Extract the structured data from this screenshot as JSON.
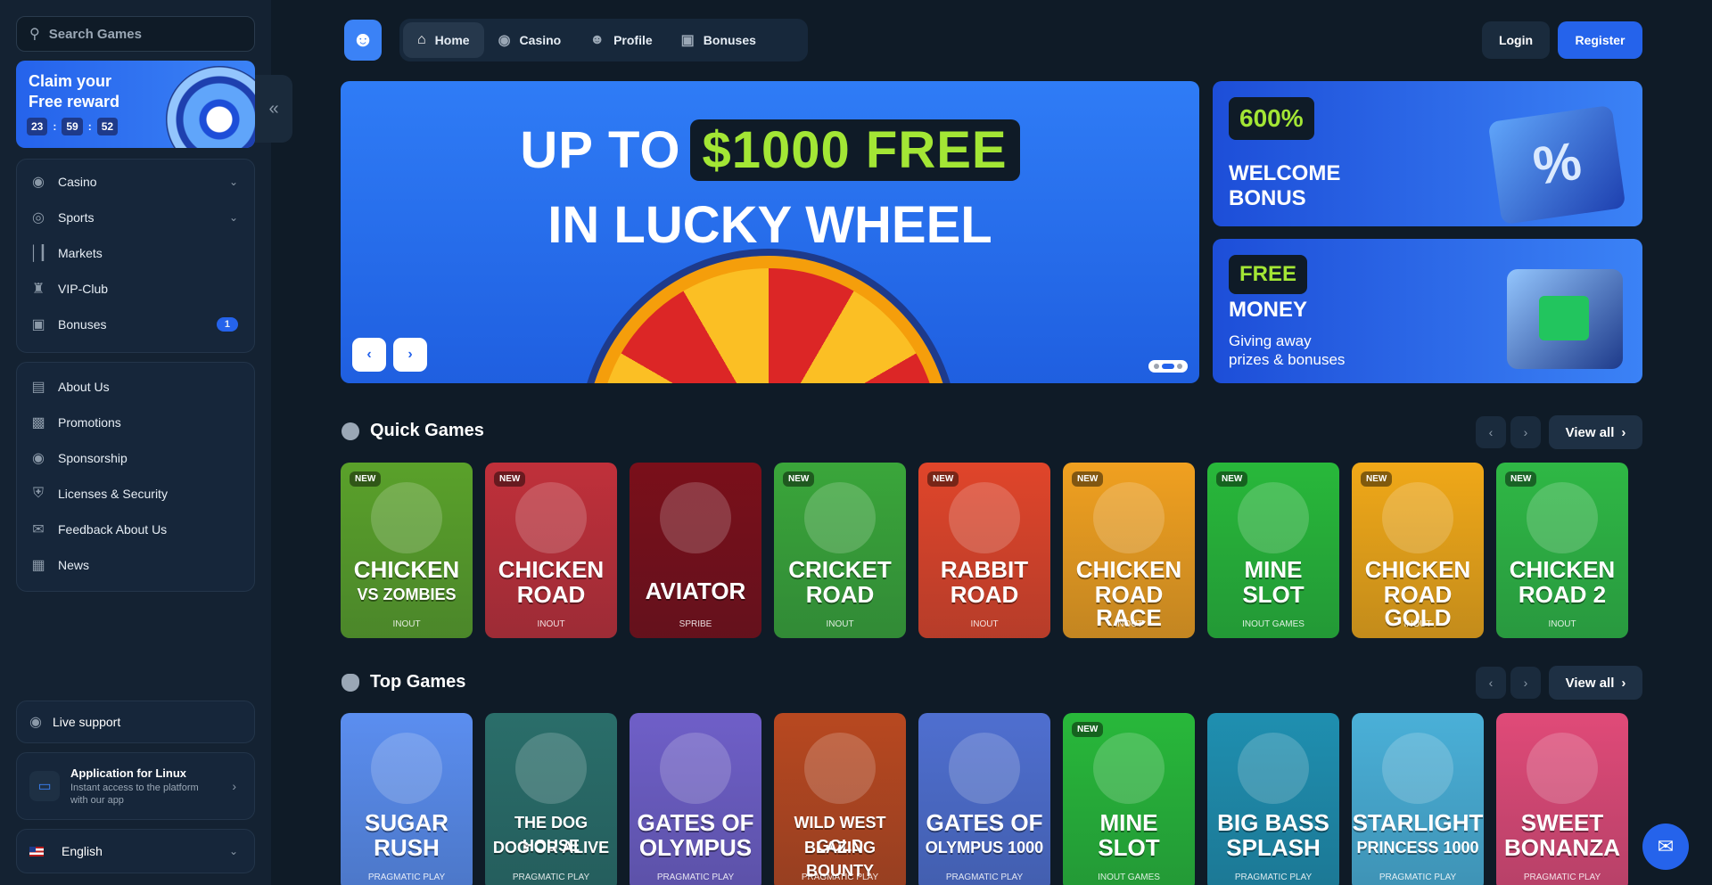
{
  "search": {
    "placeholder": "Search Games"
  },
  "reward": {
    "title_line1": "Claim your",
    "title_line2": "Free reward",
    "hours": "23",
    "minutes": "59",
    "seconds": "52"
  },
  "sidebar": {
    "main_items": [
      {
        "label": "Casino",
        "icon": "casino-chip-icon",
        "expandable": true
      },
      {
        "label": "Sports",
        "icon": "globe-icon",
        "expandable": true
      },
      {
        "label": "Markets",
        "icon": "candlestick-icon"
      },
      {
        "label": "VIP-Club",
        "icon": "crown-icon"
      },
      {
        "label": "Bonuses",
        "icon": "gift-icon",
        "badge": "1"
      }
    ],
    "info_items": [
      {
        "label": "About Us",
        "icon": "book-icon"
      },
      {
        "label": "Promotions",
        "icon": "promo-icon"
      },
      {
        "label": "Sponsorship",
        "icon": "sponsor-icon"
      },
      {
        "label": "Licenses & Security",
        "icon": "shield-icon"
      },
      {
        "label": "Feedback About Us",
        "icon": "feedback-icon"
      },
      {
        "label": "News",
        "icon": "news-icon"
      }
    ],
    "live_support": "Live support",
    "app": {
      "title": "Application for Linux",
      "subtitle_line1": "Instant access to the platform",
      "subtitle_line2": "with our app"
    },
    "language": "English"
  },
  "topnav": {
    "tabs": [
      {
        "label": "Home",
        "icon": "home-icon",
        "active": true
      },
      {
        "label": "Casino",
        "icon": "casino-chip-icon"
      },
      {
        "label": "Profile",
        "icon": "user-icon"
      },
      {
        "label": "Bonuses",
        "icon": "gift-icon"
      }
    ],
    "login": "Login",
    "register": "Register"
  },
  "hero": {
    "line1_pre": "UP TO",
    "line1_highlight": "$1000 FREE",
    "line2": "IN LUCKY WHEEL"
  },
  "welcome": {
    "pill": "600%",
    "line1": "WELCOME",
    "line2": "BONUS"
  },
  "free_money": {
    "pill": "FREE",
    "line1": "MONEY",
    "sub1": "Giving away",
    "sub2": "prizes & bonuses"
  },
  "quick_games": {
    "title": "Quick Games",
    "view_all": "View all",
    "games": [
      {
        "name1": "CHICKEN",
        "name2": "VS ZOMBIES",
        "provider": "INOUT",
        "new": "NEW",
        "color": "#5aa12a"
      },
      {
        "name1": "CHICKEN",
        "name2": "ROAD",
        "provider": "INOUT",
        "new": "NEW",
        "color": "#c0303a"
      },
      {
        "name1": "AVIATOR",
        "name2": "",
        "provider": "SPRIBE",
        "new": "",
        "color": "#7a0f1a"
      },
      {
        "name1": "CRICKET",
        "name2": "ROAD",
        "provider": "INOUT",
        "new": "NEW",
        "color": "#3aa63a"
      },
      {
        "name1": "RABBIT",
        "name2": "ROAD",
        "provider": "INOUT",
        "new": "NEW",
        "color": "#e0452a"
      },
      {
        "name1": "CHICKEN",
        "name2": "ROAD RACE",
        "provider": "INOUT",
        "new": "NEW",
        "color": "#f0a020"
      },
      {
        "name1": "MINE",
        "name2": "SLOT",
        "provider": "INOUT GAMES",
        "new": "NEW",
        "color": "#28b83a"
      },
      {
        "name1": "CHICKEN",
        "name2": "ROAD GOLD",
        "provider": "INOUT",
        "new": "NEW",
        "color": "#f0a818"
      },
      {
        "name1": "CHICKEN",
        "name2": "ROAD 2",
        "provider": "INOUT",
        "new": "NEW",
        "color": "#2fb845"
      }
    ]
  },
  "top_games": {
    "title": "Top Games",
    "view_all": "View all",
    "games": [
      {
        "name1": "SUGAR",
        "name2": "RUSH",
        "provider": "PRAGMATIC PLAY",
        "new": "",
        "color": "#5b8ef0"
      },
      {
        "name1": "THE DOG HOUSE",
        "name2": "DOG OR ALIVE",
        "provider": "PRAGMATIC PLAY",
        "new": "",
        "color": "#2a6e6a"
      },
      {
        "name1": "GATES OF",
        "name2": "OLYMPUS",
        "provider": "PRAGMATIC PLAY",
        "new": "",
        "color": "#6f5fc8"
      },
      {
        "name1": "WILD WEST GOLD",
        "name2": "BLAZING BOUNTY",
        "provider": "PRAGMATIC PLAY",
        "new": "",
        "color": "#b84820"
      },
      {
        "name1": "GATES OF",
        "name2": "OLYMPUS 1000",
        "provider": "PRAGMATIC PLAY",
        "new": "",
        "color": "#4f6fd0"
      },
      {
        "name1": "MINE",
        "name2": "SLOT",
        "provider": "INOUT GAMES",
        "new": "NEW",
        "color": "#28b83a"
      },
      {
        "name1": "BIG BASS",
        "name2": "SPLASH",
        "provider": "PRAGMATIC PLAY",
        "new": "",
        "color": "#1f8fb0"
      },
      {
        "name1": "STARLIGHT",
        "name2": "PRINCESS 1000",
        "provider": "PRAGMATIC PLAY",
        "new": "",
        "color": "#4ab0d8"
      },
      {
        "name1": "SWEET",
        "name2": "BONANZA",
        "provider": "PRAGMATIC PLAY",
        "new": "",
        "color": "#e04a78"
      }
    ]
  }
}
